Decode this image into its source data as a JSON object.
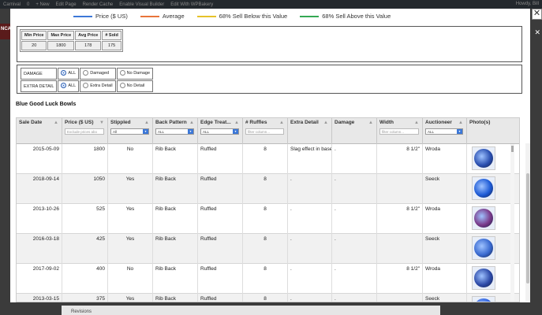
{
  "background": {
    "adminbar_items": [
      "Carnival",
      "0",
      "+ New",
      "Edit Page",
      "Render Cache",
      "Enable Visual Builder",
      "Edit With WPBakery"
    ],
    "adminbar_right": "Howdy, Bill",
    "side_label": "NCAR",
    "bottom_label": "Revisions"
  },
  "modal": {
    "close_label": "✕",
    "legend": [
      {
        "label": "Price ($ US)",
        "color": "#3c78d8"
      },
      {
        "label": "Average",
        "color": "#e8743b"
      },
      {
        "label": "68% Sell Below this Value",
        "color": "#e6c229"
      },
      {
        "label": "68% Sell Above this Value",
        "color": "#34a853"
      }
    ],
    "stats": {
      "headers": [
        "Min Price",
        "Max Price",
        "Avg Price",
        "# Sold"
      ],
      "values": [
        "20",
        "1800",
        "178",
        "175"
      ]
    },
    "filters": [
      {
        "label": "DAMAGE",
        "options": [
          "ALL",
          "Damaged",
          "No Damage"
        ],
        "selected": 0
      },
      {
        "label": "EXTRA DETAIL",
        "options": [
          "ALL",
          "Extra Detail",
          "No Detail"
        ],
        "selected": 0
      }
    ],
    "section_title": "Blue Good Luck Bowls",
    "columns": [
      {
        "label": "Sale Date",
        "filter": ""
      },
      {
        "label": "Price ($ US)",
        "filter": "Exclude prices abo"
      },
      {
        "label": "Stippled",
        "filter": "All",
        "select": true
      },
      {
        "label": "Back Pattern",
        "filter": "ALL",
        "select": true
      },
      {
        "label": "Edge Treat...",
        "filter": "ALL",
        "select": true
      },
      {
        "label": "# Ruffles",
        "filter": "filter column..."
      },
      {
        "label": "Extra Detail",
        "filter": ""
      },
      {
        "label": "Damage",
        "filter": ""
      },
      {
        "label": "Width",
        "filter": "filter column..."
      },
      {
        "label": "Auctioneer",
        "filter": "ALL",
        "select": true
      },
      {
        "label": "Photo(s)",
        "filter": ""
      }
    ],
    "rows": [
      {
        "date": "2015-05-09",
        "price": "1800",
        "stippled": "No",
        "back": "Rib Back",
        "edge": "Ruffled",
        "ruffles": "8",
        "extra": "Slag effect in base",
        "damage": ".",
        "width": "8 1/2\"",
        "auctioneer": "Wroda",
        "photo_color": "#2a4fb0"
      },
      {
        "date": "2018-09-14",
        "price": "1050",
        "stippled": "Yes",
        "back": "Rib Back",
        "edge": "Ruffled",
        "ruffles": "8",
        "extra": ".",
        "damage": ".",
        "width": "",
        "auctioneer": "Seeck",
        "photo_color": "#1e5bd6"
      },
      {
        "date": "2013-10-26",
        "price": "525",
        "stippled": "Yes",
        "back": "Rib Back",
        "edge": "Ruffled",
        "ruffles": "8",
        "extra": ".",
        "damage": ".",
        "width": "8 1/2\"",
        "auctioneer": "Wroda",
        "photo_color": "#7a3a8a"
      },
      {
        "date": "2016-03-18",
        "price": "425",
        "stippled": "Yes",
        "back": "Rib Back",
        "edge": "Ruffled",
        "ruffles": "8",
        "extra": ".",
        "damage": ".",
        "width": "",
        "auctioneer": "Seeck",
        "photo_color": "#3a6ad0"
      },
      {
        "date": "2017-09-02",
        "price": "400",
        "stippled": "No",
        "back": "Rib Back",
        "edge": "Ruffled",
        "ruffles": "8",
        "extra": ".",
        "damage": ".",
        "width": "8 1/2\"",
        "auctioneer": "Wroda",
        "photo_color": "#2d4aa8"
      },
      {
        "date": "2013-03-15",
        "price": "375",
        "stippled": "Yes",
        "back": "Rib Back",
        "edge": "Ruffled",
        "ruffles": "8",
        "extra": ".",
        "damage": ".",
        "width": "",
        "auctioneer": "Seeck",
        "photo_color": "#2f62e0"
      }
    ]
  }
}
